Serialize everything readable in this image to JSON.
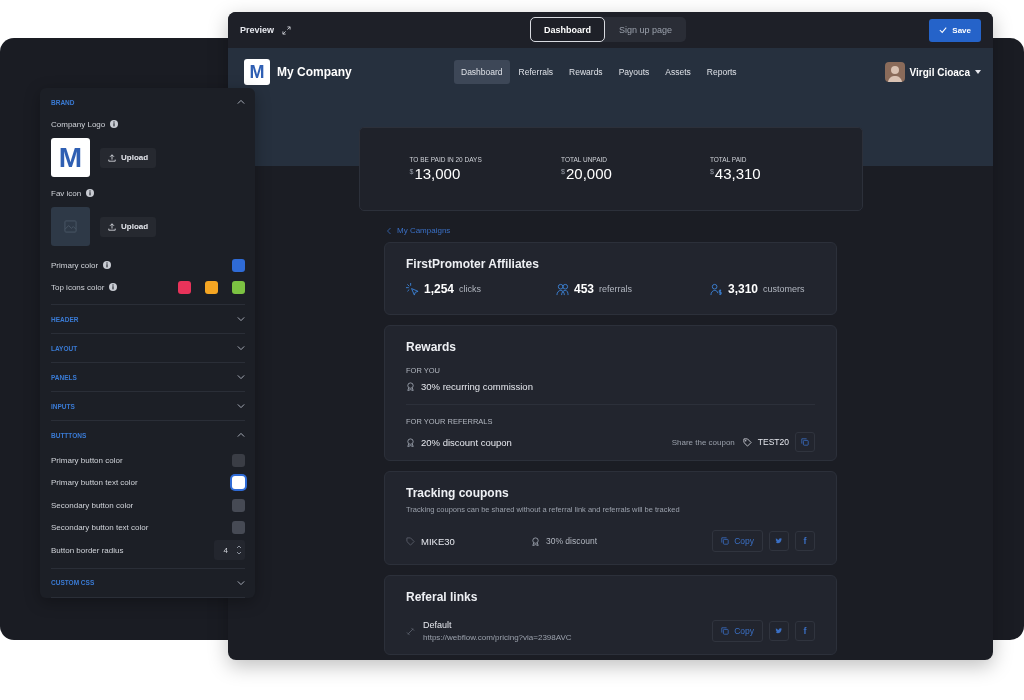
{
  "preview": {
    "title": "Preview",
    "tabs": [
      {
        "label": "Dashboard",
        "selected": true
      },
      {
        "label": "Sign up page",
        "selected": false
      }
    ],
    "save": "Save"
  },
  "app": {
    "logo_letter": "M",
    "company": "My Company",
    "nav": [
      {
        "label": "Dashboard",
        "selected": true
      },
      {
        "label": "Referrals",
        "selected": false
      },
      {
        "label": "Rewards",
        "selected": false
      },
      {
        "label": "Payouts",
        "selected": false
      },
      {
        "label": "Assets",
        "selected": false
      },
      {
        "label": "Reports",
        "selected": false
      }
    ],
    "user": "Virgil Cioaca"
  },
  "stats": [
    {
      "label": "TO BE PAID IN 20 DAYS",
      "currency": "$",
      "amount": "13,000"
    },
    {
      "label": "TOTAL UNPAID",
      "currency": "$",
      "amount": "20,000"
    },
    {
      "label": "TOTAL PAID",
      "currency": "$",
      "amount": "43,310"
    }
  ],
  "back_link": "My Campaigns",
  "campaign": {
    "title": "FirstPromoter Affiliates",
    "metrics": [
      {
        "kind": "clicks",
        "value": "1,254",
        "unit": "clicks"
      },
      {
        "kind": "referrals",
        "value": "453",
        "unit": "referrals"
      },
      {
        "kind": "customers",
        "value": "3,310",
        "unit": "customers"
      }
    ]
  },
  "rewards": {
    "title": "Rewards",
    "groups": [
      {
        "heading": "FOR YOU",
        "reward": "30% recurring commission"
      },
      {
        "heading": "FOR YOUR REFERRALS",
        "reward": "20% discount coupon",
        "share_label": "Share the coupon",
        "coupon": "TEST20"
      }
    ]
  },
  "tracking": {
    "title": "Tracking coupons",
    "description": "Tracking coupons can be shared without a referral link and referrals will be tracked",
    "coupons": [
      {
        "code": "MIKE30",
        "reward": "30% discount",
        "copy": "Copy",
        "share": [
          {
            "kind": "bird"
          },
          {
            "kind": "letter",
            "label": "f"
          }
        ]
      }
    ]
  },
  "links": {
    "title": "Referal links",
    "items": [
      {
        "name": "Default",
        "url": "https://webflow.com/pricing?via=2398AVC",
        "copy": "Copy",
        "share": [
          {
            "kind": "bird"
          },
          {
            "kind": "letter",
            "label": "f"
          }
        ]
      }
    ]
  },
  "settings": {
    "sections": [
      {
        "kind": "brand",
        "title": "BRAND",
        "expanded": true,
        "logo_label": "Company Logo",
        "logo_letter": "M",
        "fav_label": "Fav icon",
        "upload": "Upload",
        "fav_upload": "Upload",
        "color_rows": [
          {
            "label": "Primary color",
            "swatches": [
              {
                "color": "#2f6bd6"
              }
            ]
          },
          {
            "label": "Top icons color",
            "swatches": [
              {
                "color": "#e8335a"
              },
              {
                "color": "#f5a623"
              },
              {
                "color": "#7cc242"
              }
            ]
          }
        ]
      },
      {
        "title": "HEADER",
        "expanded": false
      },
      {
        "title": "LAYOUT",
        "expanded": false
      },
      {
        "title": "PANELS",
        "expanded": false
      },
      {
        "title": "INPUTS",
        "expanded": false
      },
      {
        "kind": "rows",
        "title": "BUTTTONS",
        "expanded": true,
        "rows": [
          {
            "kind": "swatch",
            "label": "Primary button color",
            "color": "#3a3d45",
            "selected": false
          },
          {
            "kind": "swatch",
            "label": "Primary button text color",
            "color": "#ffffff",
            "selected": true
          },
          {
            "kind": "swatch",
            "label": "Secondary button color",
            "color": "#464a54",
            "selected": false
          },
          {
            "kind": "swatch",
            "label": "Secondary button text color",
            "color": "#464a54",
            "selected": false
          },
          {
            "kind": "number",
            "label": "Button border radius",
            "value": "4"
          }
        ]
      },
      {
        "title": "CUSTOM CSS",
        "expanded": false
      }
    ]
  }
}
